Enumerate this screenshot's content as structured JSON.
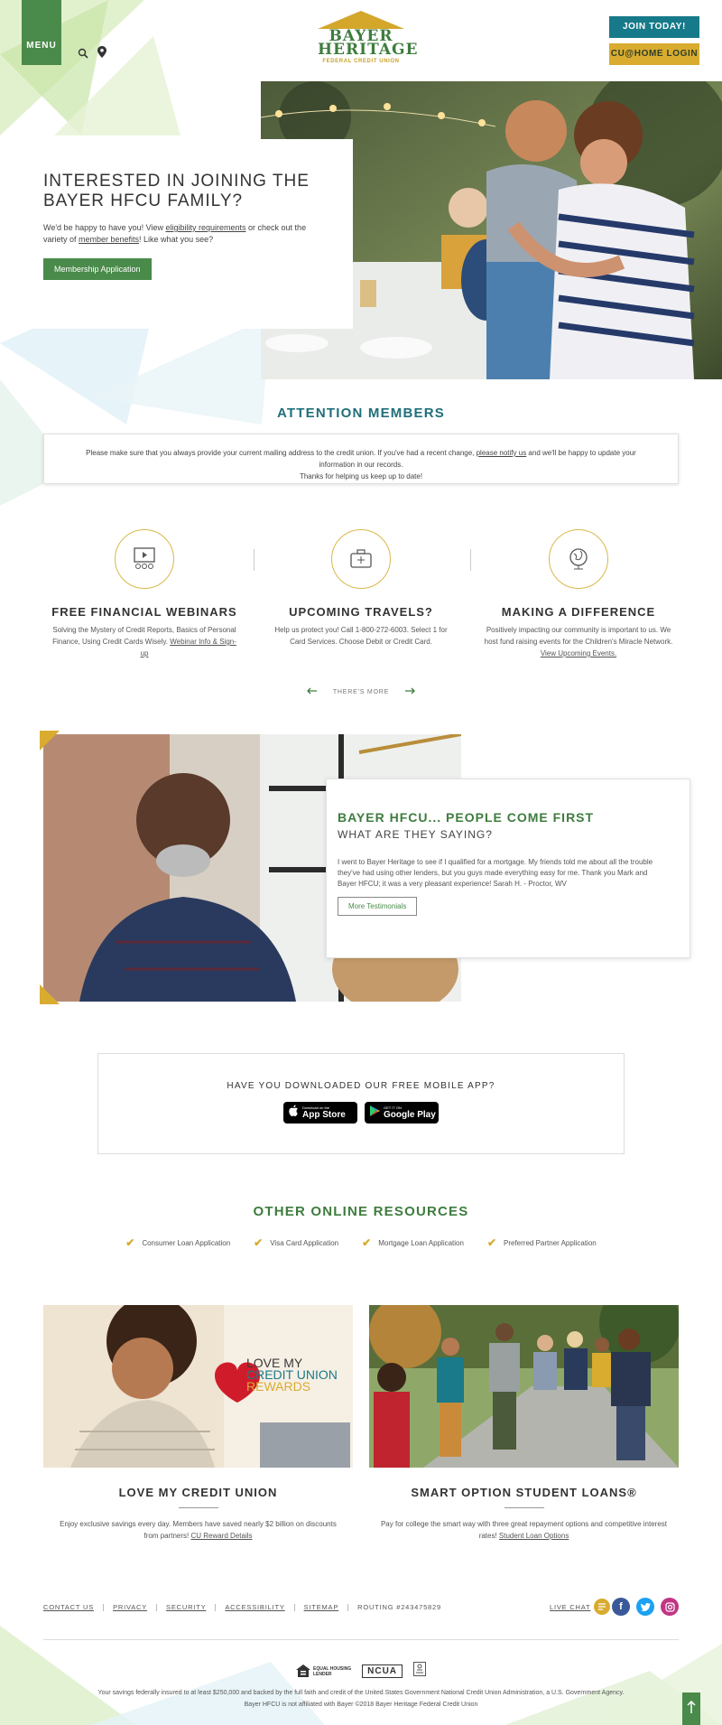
{
  "header": {
    "menu_label": "MENU",
    "logo_line1": "BAYER",
    "logo_line2": "HERITAGE",
    "logo_line3": "FEDERAL CREDIT UNION",
    "join_label": "JOIN TODAY!",
    "login_label": "CU@HOME LOGIN"
  },
  "hero": {
    "title": "INTERESTED IN JOINING THE BAYER HFCU FAMILY?",
    "text_prefix": "We'd be happy to have you! View ",
    "link1": "eligibility requirements",
    "text_mid": " or check out the variety of ",
    "link2": "member benefits",
    "text_suffix": "! Like what you see?",
    "button": "Membership Application"
  },
  "attention": {
    "title": "ATTENTION MEMBERS",
    "text_prefix": "Please make sure that you always provide your current mailing address to the credit union. If you've had a recent change, ",
    "link": "please notify us",
    "text_suffix": " and we'll be happy to update your information in our records.",
    "text_line2": "Thanks for helping us keep up to date!"
  },
  "features": [
    {
      "title": "FREE FINANCIAL WEBINARS",
      "text": "Solving the Mystery of Credit Reports, Basics of Personal Finance, Using Credit Cards Wisely. ",
      "link": "Webinar Info & Sign-up",
      "icon": "webinar-icon"
    },
    {
      "title": "UPCOMING TRAVELS?",
      "text": "Help us protect you! Call 1-800-272-6003. Select 1 for Card Services. Choose Debit or Credit Card.",
      "link": "",
      "icon": "suitcase-icon"
    },
    {
      "title": "MAKING A DIFFERENCE",
      "text": "Positively impacting our community is important to us. We host fund raising events for the Children's Miracle Network. ",
      "link": "View Upcoming Events.",
      "icon": "globe-icon"
    }
  ],
  "more_label": "THERE'S MORE",
  "testimonial": {
    "title": "BAYER HFCU... PEOPLE COME FIRST",
    "subtitle": "WHAT ARE THEY SAYING?",
    "quote": "I went to Bayer Heritage to see if I qualified for a mortgage. My friends told me about all the trouble they've had using other lenders, but you guys made everything easy for me. Thank you Mark and Bayer HFCU; it was a very pleasant experience!  Sarah H. - Proctor, WV",
    "button": "More Testimonials"
  },
  "app": {
    "title": "HAVE YOU DOWNLOADED OUR FREE MOBILE APP?",
    "appstore_small": "Download on the",
    "appstore_big": "App Store",
    "googleplay_small": "GET IT ON",
    "googleplay_big": "Google Play"
  },
  "resources": {
    "title": "OTHER ONLINE RESOURCES",
    "items": [
      "Consumer Loan Application",
      "Visa Card Application",
      "Mortgage Loan Application",
      "Preferred Partner Application"
    ]
  },
  "promos": [
    {
      "title": "LOVE MY CREDIT UNION",
      "image_text_1": "LOVE MY",
      "image_text_2": "CREDIT UNION",
      "image_text_3": "REWARDS",
      "text": "Enjoy exclusive savings every day. Members have saved nearly $2 billion on discounts from partners! ",
      "link": "CU Reward Details"
    },
    {
      "title": "SMART OPTION STUDENT LOANS®",
      "text": "Pay for college the smart way with three great repayment options and competitive interest rates! ",
      "link": "Student Loan Options"
    }
  ],
  "footer": {
    "links": [
      "CONTACT US",
      "PRIVACY",
      "SECURITY",
      "ACCESSIBILITY",
      "SITEMAP"
    ],
    "routing": "ROUTING #243475829",
    "live_chat": "LIVE CHAT",
    "ehl_line1": "EQUAL HOUSING",
    "ehl_line2": "LENDER",
    "ncua": "NCUA",
    "legal1": "Your savings federally insured to at least $250,000 and backed by the full faith and credit of the United States Government National Credit Union Administration, a U.S. Government Agency.",
    "legal2": "Bayer HFCU is not affiliated with Bayer    ©2018 Bayer Heritage Federal Credit Union"
  },
  "colors": {
    "green": "#4a8a4a",
    "teal": "#177a8a",
    "gold": "#d9ab2f"
  }
}
